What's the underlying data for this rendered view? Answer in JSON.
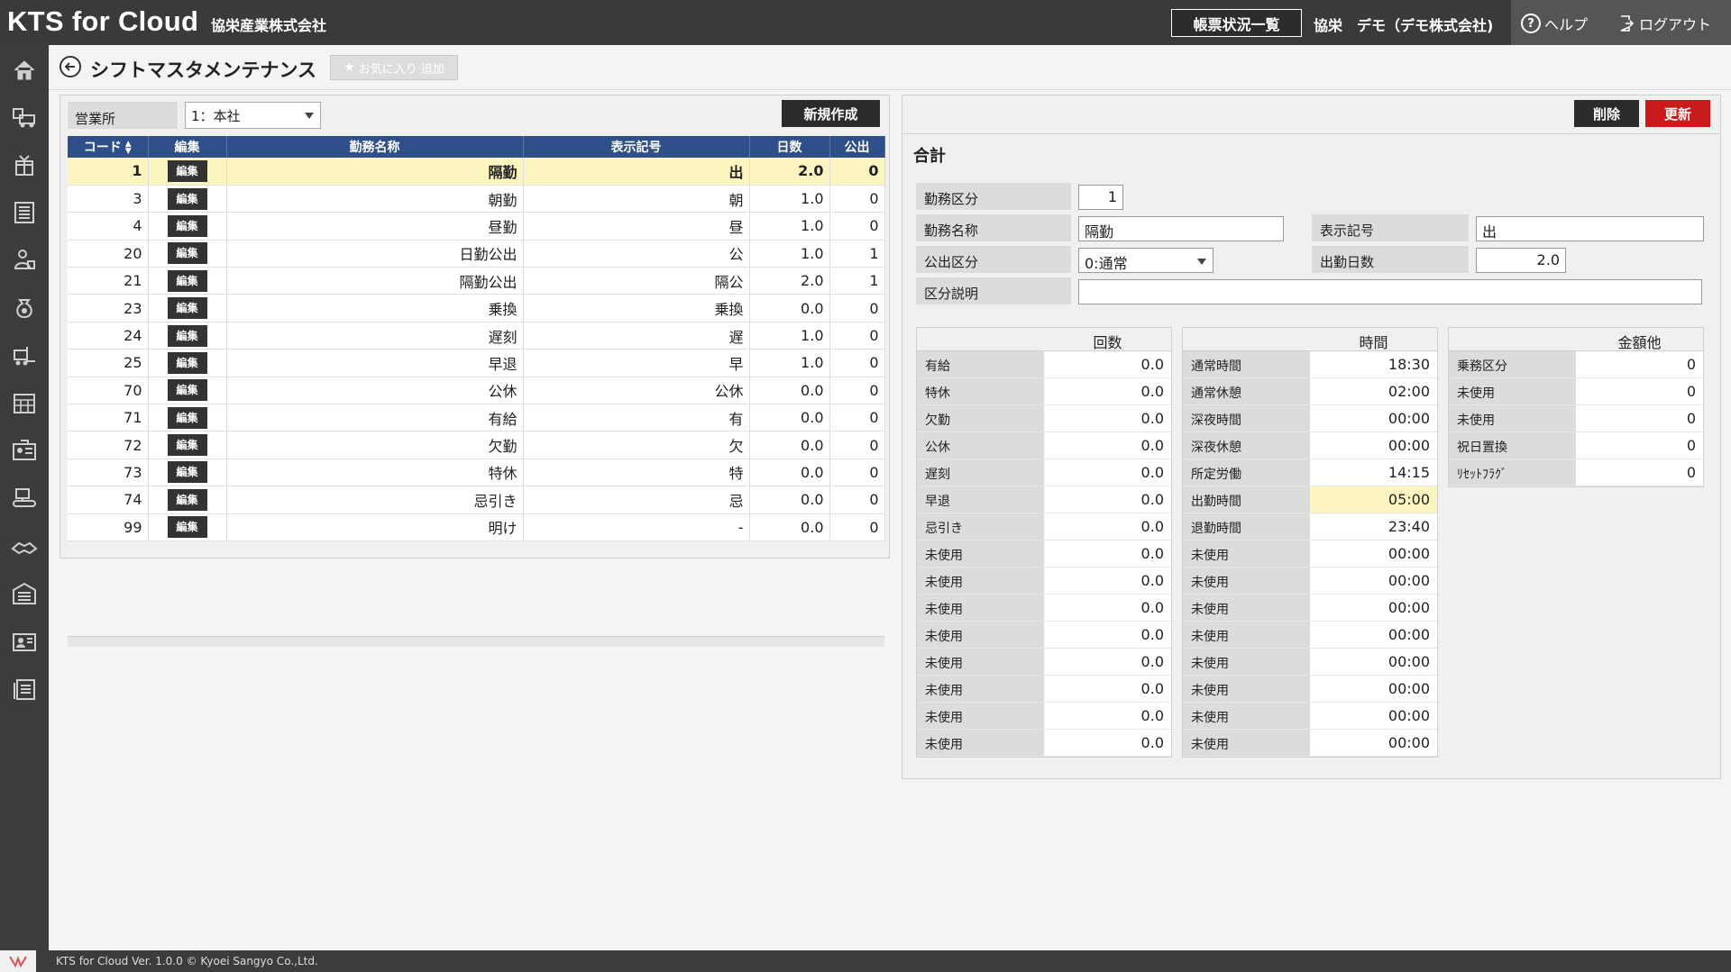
{
  "header": {
    "brand": "KTS for Cloud",
    "company": "協栄産業株式会社",
    "status_button": "帳票状況一覧",
    "user_short": "協栄",
    "user_org": "デモ（デモ株式会社)",
    "help": "ヘルプ",
    "logout": "ログアウト"
  },
  "sidebar": {
    "icons": [
      "home-icon",
      "delivery-truck-icon",
      "gift-box-icon",
      "building-list-icon",
      "worker-icon",
      "coin-bag-icon",
      "forklift-icon",
      "calendar-grid-icon",
      "id-card-icon",
      "conveyor-icon",
      "hands-icon",
      "warehouse-icon",
      "person-card-icon",
      "document-stack-icon"
    ]
  },
  "page": {
    "title": "シフトマスタメンテナンス",
    "favorite_button": "お気に入り 追加"
  },
  "left": {
    "office_label": "営業所",
    "office_value": "1：本社",
    "new_button": "新規作成",
    "columns": [
      "コード",
      "編集",
      "勤務名称",
      "表示記号",
      "日数",
      "公出"
    ],
    "edit_label": "編集",
    "rows": [
      {
        "code": "1",
        "name": "隔勤",
        "mark": "出",
        "days": "2.0",
        "koshutsu": "0"
      },
      {
        "code": "3",
        "name": "朝勤",
        "mark": "朝",
        "days": "1.0",
        "koshutsu": "0"
      },
      {
        "code": "4",
        "name": "昼勤",
        "mark": "昼",
        "days": "1.0",
        "koshutsu": "0"
      },
      {
        "code": "20",
        "name": "日勤公出",
        "mark": "公",
        "days": "1.0",
        "koshutsu": "1"
      },
      {
        "code": "21",
        "name": "隔勤公出",
        "mark": "隔公",
        "days": "2.0",
        "koshutsu": "1"
      },
      {
        "code": "23",
        "name": "乗換",
        "mark": "乗換",
        "days": "0.0",
        "koshutsu": "0"
      },
      {
        "code": "24",
        "name": "遅刻",
        "mark": "遅",
        "days": "1.0",
        "koshutsu": "0"
      },
      {
        "code": "25",
        "name": "早退",
        "mark": "早",
        "days": "1.0",
        "koshutsu": "0"
      },
      {
        "code": "70",
        "name": "公休",
        "mark": "公休",
        "days": "0.0",
        "koshutsu": "0"
      },
      {
        "code": "71",
        "name": "有給",
        "mark": "有",
        "days": "0.0",
        "koshutsu": "0"
      },
      {
        "code": "72",
        "name": "欠勤",
        "mark": "欠",
        "days": "0.0",
        "koshutsu": "0"
      },
      {
        "code": "73",
        "name": "特休",
        "mark": "特",
        "days": "0.0",
        "koshutsu": "0"
      },
      {
        "code": "74",
        "name": "忌引き",
        "mark": "忌",
        "days": "0.0",
        "koshutsu": "0"
      },
      {
        "code": "99",
        "name": "明け",
        "mark": "-",
        "days": "0.0",
        "koshutsu": "0"
      }
    ],
    "selected_index": 0
  },
  "right": {
    "delete_button": "削除",
    "update_button": "更新",
    "section_title": "合計",
    "fields": {
      "work_division_label": "勤務区分",
      "work_division_value": "1",
      "work_name_label": "勤務名称",
      "work_name_value": "隔勤",
      "display_mark_label": "表示記号",
      "display_mark_value": "出",
      "koshutsu_label": "公出区分",
      "koshutsu_value": "0:通常",
      "attendance_days_label": "出勤日数",
      "attendance_days_value": "2.0",
      "description_label": "区分説明",
      "description_value": ""
    },
    "count_table": {
      "header": "回数",
      "rows": [
        {
          "label": "有給",
          "value": "0.0"
        },
        {
          "label": "特休",
          "value": "0.0"
        },
        {
          "label": "欠勤",
          "value": "0.0"
        },
        {
          "label": "公休",
          "value": "0.0"
        },
        {
          "label": "遅刻",
          "value": "0.0"
        },
        {
          "label": "早退",
          "value": "0.0"
        },
        {
          "label": "忌引き",
          "value": "0.0"
        },
        {
          "label": "未使用",
          "value": "0.0"
        },
        {
          "label": "未使用",
          "value": "0.0"
        },
        {
          "label": "未使用",
          "value": "0.0"
        },
        {
          "label": "未使用",
          "value": "0.0"
        },
        {
          "label": "未使用",
          "value": "0.0"
        },
        {
          "label": "未使用",
          "value": "0.0"
        },
        {
          "label": "未使用",
          "value": "0.0"
        },
        {
          "label": "未使用",
          "value": "0.0"
        }
      ]
    },
    "time_table": {
      "header": "時間",
      "highlight_index": 5,
      "rows": [
        {
          "label": "通常時間",
          "value": "18:30"
        },
        {
          "label": "通常休憩",
          "value": "02:00"
        },
        {
          "label": "深夜時間",
          "value": "00:00"
        },
        {
          "label": "深夜休憩",
          "value": "00:00"
        },
        {
          "label": "所定労働",
          "value": "14:15"
        },
        {
          "label": "出勤時間",
          "value": "05:00"
        },
        {
          "label": "退勤時間",
          "value": "23:40"
        },
        {
          "label": "未使用",
          "value": "00:00"
        },
        {
          "label": "未使用",
          "value": "00:00"
        },
        {
          "label": "未使用",
          "value": "00:00"
        },
        {
          "label": "未使用",
          "value": "00:00"
        },
        {
          "label": "未使用",
          "value": "00:00"
        },
        {
          "label": "未使用",
          "value": "00:00"
        },
        {
          "label": "未使用",
          "value": "00:00"
        },
        {
          "label": "未使用",
          "value": "00:00"
        }
      ]
    },
    "amount_table": {
      "header": "金額他",
      "rows": [
        {
          "label": "乗務区分",
          "value": "0"
        },
        {
          "label": "未使用",
          "value": "0"
        },
        {
          "label": "未使用",
          "value": "0"
        },
        {
          "label": "祝日置換",
          "value": "0"
        },
        {
          "label": "ﾘｾｯﾄﾌﾗｸﾞ",
          "value": "0"
        }
      ]
    }
  },
  "footer": {
    "copyright": "KTS for Cloud Ver. 1.0.0 © Kyoei Sangyo Co.,Ltd."
  },
  "colors": {
    "header_bg": "#3a3a3a",
    "table_header": "#2e4f8a",
    "selected_row": "#fdf5c0",
    "update_button": "#c91b1b"
  }
}
